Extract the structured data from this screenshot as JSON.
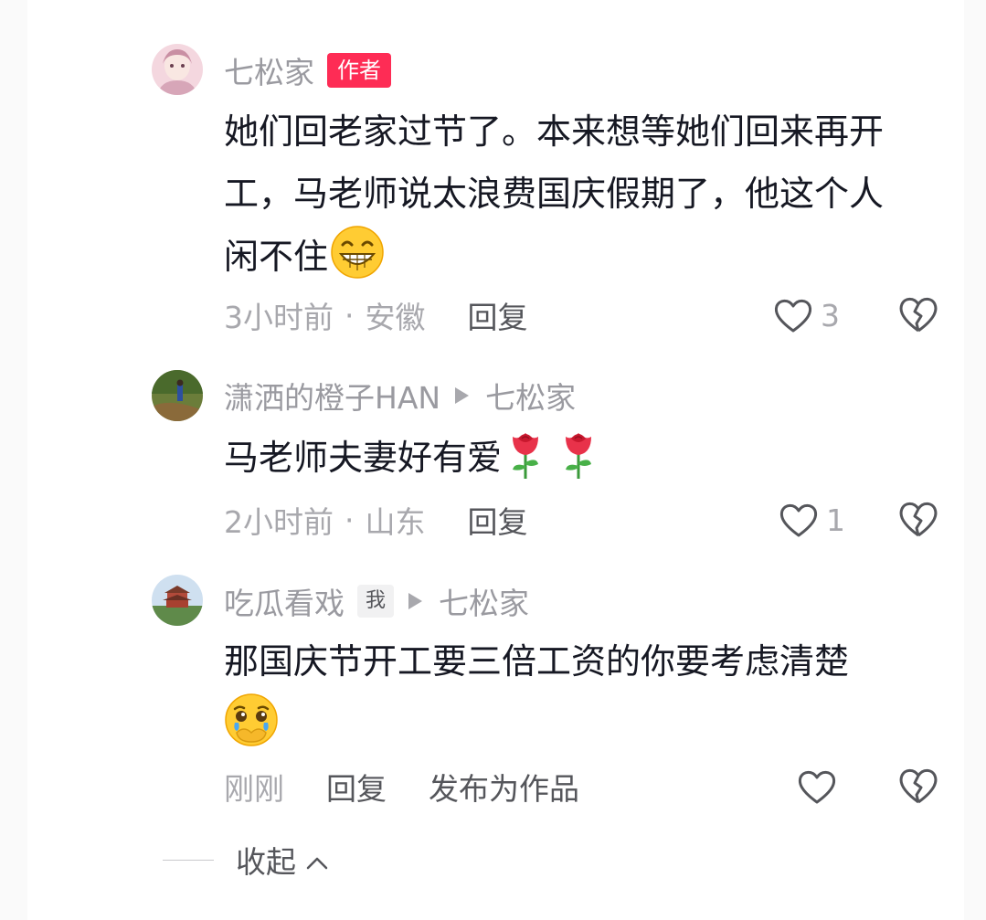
{
  "comments": [
    {
      "author": "七松家",
      "author_badge": "作者",
      "text_line1": "她们回老家过节了。本来想等她们回来再开",
      "text_line2": "工，马老师说太浪费国庆假期了，他这个人",
      "text_line3": "闲不住",
      "emoji": "grinning-face-icon",
      "time": "3小时前",
      "separator": "·",
      "location": "安徽",
      "reply_label": "回复",
      "likes": "3"
    },
    {
      "author": "潇洒的橙子HAN",
      "reply_to": "七松家",
      "text": "马老师夫妻好有爱",
      "emojis": [
        "rose-icon",
        "rose-icon"
      ],
      "time": "2小时前",
      "separator": "·",
      "location": "山东",
      "reply_label": "回复",
      "likes": "1"
    },
    {
      "author": "吃瓜看戏",
      "me_badge": "我",
      "reply_to": "七松家",
      "text": "那国庆节开工要三倍工资的你要考虑清楚",
      "emoji": "pleading-face-icon",
      "time": "刚刚",
      "reply_label": "回复",
      "publish_label": "发布为作品"
    }
  ],
  "collapse_label": "收起",
  "colors": {
    "accent": "#fe2c55",
    "secondary_text": "#a8a8ad",
    "primary_text": "#161823"
  }
}
